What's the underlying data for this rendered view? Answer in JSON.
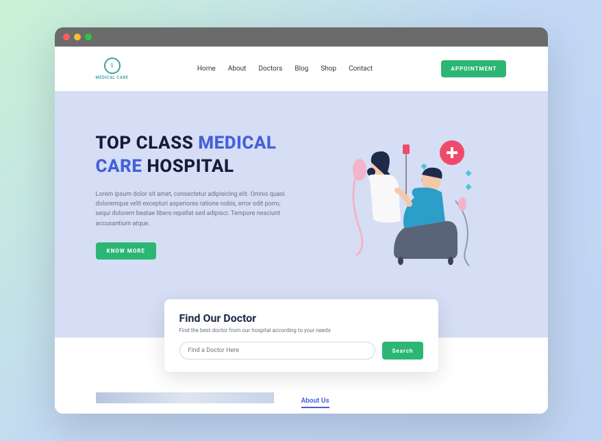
{
  "logo": {
    "text": "MEDICAL CARE"
  },
  "nav": {
    "home": "Home",
    "about": "About",
    "doctors": "Doctors",
    "blog": "Blog",
    "shop": "Shop",
    "contact": "Contact"
  },
  "appointment_btn": "APPOINTMENT",
  "hero": {
    "title_1": "TOP CLASS ",
    "title_hl1": "MEDICAL",
    "title_hl2": "CARE",
    "title_2": " HOSPITAL",
    "text": "Lorem ipsum dolor sit amet, consectetur adipisicing elit. Omnis quasi doloremque velit excepturi asperiores ratione nobis, error odit porro, sequi dolorem beatae libero repellat sed adipisci. Tempore nesciunt accusantium atque.",
    "know_btn": "KNOW MORE"
  },
  "search": {
    "title": "Find Our Doctor",
    "subtitle": "Find the best doctor from our hospital according to your needs",
    "placeholder": "Find a Doctor Here",
    "button": "Search"
  },
  "about": {
    "link": "About Us"
  }
}
